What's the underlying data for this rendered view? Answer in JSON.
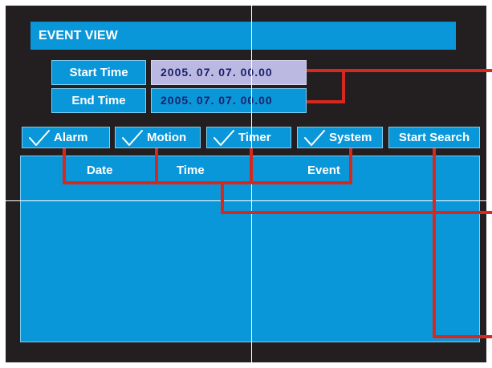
{
  "window": {
    "title": "EVENT VIEW"
  },
  "time_range": {
    "start": {
      "label": "Start Time",
      "value": "2005. 07. 07. 00.00"
    },
    "end": {
      "label": "End Time",
      "value": "2005. 07. 07. 00.00"
    }
  },
  "filters": [
    {
      "label": "Alarm",
      "checked": true,
      "icon": "checkmark-icon"
    },
    {
      "label": "Motion",
      "checked": true,
      "icon": "checkmark-icon"
    },
    {
      "label": "Timer",
      "checked": true,
      "icon": "checkmark-icon"
    },
    {
      "label": "System",
      "checked": true,
      "icon": "checkmark-icon"
    }
  ],
  "actions": {
    "start_search": "Start Search"
  },
  "event_list": {
    "columns": [
      "Date",
      "Time",
      "Event"
    ],
    "rows": []
  },
  "colors": {
    "screen_background": "#231f20",
    "panel_blue": "#0a97d9",
    "selected_field": "#bbb9e2",
    "value_text": "#1b1f6b",
    "callout_line": "#d6281f",
    "crosshair": "#ffffff"
  }
}
